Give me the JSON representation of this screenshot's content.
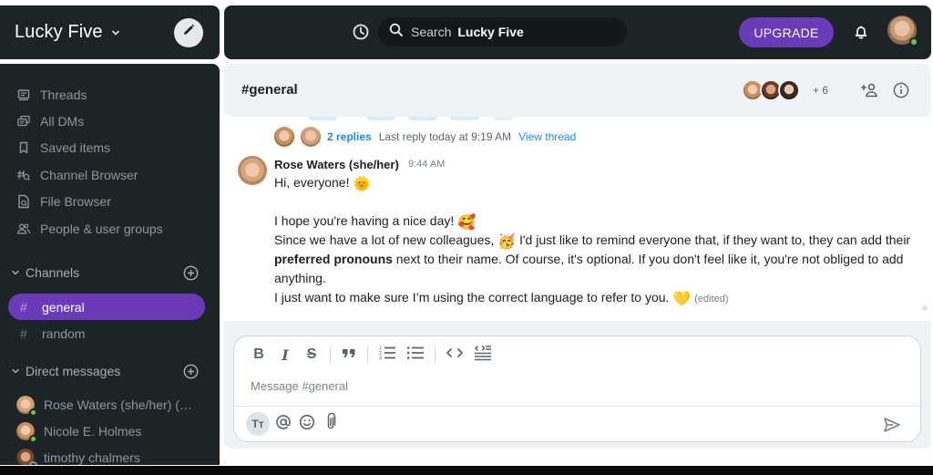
{
  "workspace": {
    "name": "Lucky Five",
    "chevron_icon": "chevron-down-icon",
    "compose_icon": "pencil-icon"
  },
  "topbar": {
    "history_icon": "clock-icon",
    "search": {
      "icon": "search-icon",
      "label": "Search",
      "scope": "Lucky Five"
    },
    "upgrade_label": "UPGRADE",
    "notification_icon": "bell-icon",
    "user_status": "online"
  },
  "sidebar": {
    "nav_items": [
      {
        "label": "Threads",
        "icon": "threads-icon"
      },
      {
        "label": "All DMs",
        "icon": "all-dms-icon"
      },
      {
        "label": "Saved items",
        "icon": "bookmark-icon"
      },
      {
        "label": "Channel Browser",
        "icon": "channel-browser-icon"
      },
      {
        "label": "File Browser",
        "icon": "file-browser-icon"
      },
      {
        "label": "People & user groups",
        "icon": "people-icon"
      }
    ],
    "channels_section": {
      "label": "Channels",
      "channels": [
        {
          "name": "general",
          "active": true
        },
        {
          "name": "random",
          "active": false
        }
      ]
    },
    "dm_section": {
      "label": "Direct messages",
      "dms": [
        {
          "name": "Rose Waters (she/her) (…",
          "status": "online"
        },
        {
          "name": "Nicole E. Holmes",
          "status": "online"
        },
        {
          "name": "timothy chalmers",
          "status": "offline"
        }
      ]
    }
  },
  "channel": {
    "title": "#general",
    "member_overflow": "+ 6",
    "add_member_icon": "add-person-icon",
    "info_icon": "info-icon"
  },
  "thread_summary": {
    "reply_count": "2 replies",
    "last_reply": "Last reply today at 9:19 AM",
    "view_label": "View thread"
  },
  "message": {
    "author": "Rose Waters (she/her)",
    "time": "9:44 AM",
    "lines": {
      "l1": "Hi, everyone!",
      "l1_emoji": "🌞",
      "l3": "I hope you're having a nice day!",
      "l3_emoji": "🥰",
      "l4a": "Since we have a lot of new colleagues,",
      "l4_emoji": "🥳",
      "l4b": "I'd just like to remind everyone that, if they want to, they can add their",
      "l5_bold": "preferred pronouns",
      "l5b": "next to their name. Of course, it's optional. If you don't feel like it, you're not obliged to add anything.",
      "l6": "I just want to make sure I’m using the correct language to refer to you.",
      "l6_emoji": "💛",
      "edited": "(edited)"
    }
  },
  "composer": {
    "placeholder": "Message #general",
    "toolbar": [
      "bold",
      "italic",
      "strikethrough",
      "quote",
      "ordered-list",
      "bullet-list",
      "code",
      "code-block"
    ],
    "format_label": "Tт",
    "bottom_tools": [
      "text-format",
      "mention",
      "emoji",
      "attachment"
    ],
    "send_icon": "send-icon"
  },
  "colors": {
    "panel_dark": "#1d2428",
    "accent_purple": "#6a3ab8",
    "link_blue": "#1f8ceb",
    "online_green": "#6cc644",
    "header_bg": "#eff3f6"
  }
}
